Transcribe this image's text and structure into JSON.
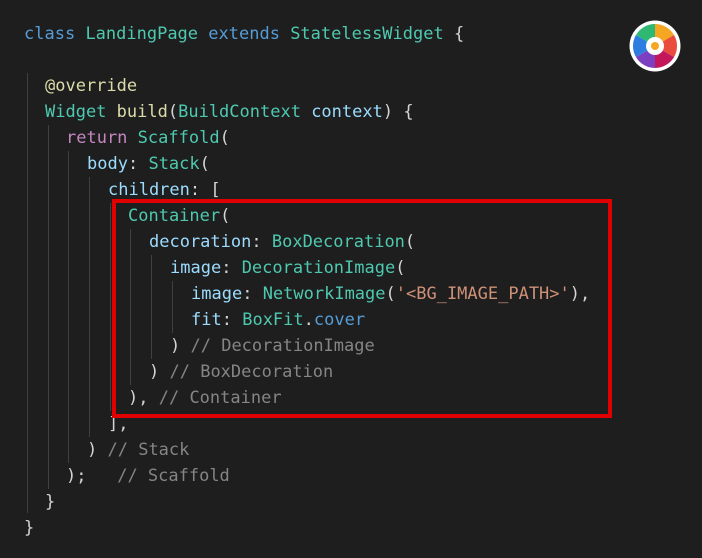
{
  "code": {
    "line1": {
      "kw_class": "class",
      "name": "LandingPage",
      "kw_extends": "extends",
      "parent": "StatelessWidget",
      "brace": "{"
    },
    "line2": {
      "decorator": "@override"
    },
    "line3": {
      "type": "Widget",
      "method": "build",
      "open": "(",
      "ptype": "BuildContext",
      "pname": "context",
      "close": ") {"
    },
    "line4": {
      "kw_return": "return",
      "cls": "Scaffold",
      "open": "("
    },
    "line5": {
      "prop": "body",
      "colon": ":",
      "cls": "Stack",
      "open": "("
    },
    "line6": {
      "prop": "children",
      "rest": ": ["
    },
    "line7": {
      "cls": "Container",
      "open": "("
    },
    "line8": {
      "prop": "decoration",
      "colon": ":",
      "cls": "BoxDecoration",
      "open": "("
    },
    "line9": {
      "prop": "image",
      "colon": ":",
      "cls": "DecorationImage",
      "open": "("
    },
    "line10": {
      "prop": "image",
      "colon": ":",
      "cls": "NetworkImage",
      "open": "(",
      "str": "'<BG_IMAGE_PATH>'",
      "close": "),"
    },
    "line11": {
      "prop": "fit",
      "colon": ":",
      "cls": "BoxFit",
      "dot": ".",
      "member": "cover"
    },
    "line12": {
      "close": ")",
      "comment": "// DecorationImage"
    },
    "line13": {
      "close": ")",
      "comment": "// BoxDecoration"
    },
    "line14": {
      "close": "),",
      "comment": "// Container"
    },
    "line15": {
      "close": "],"
    },
    "line16": {
      "close": ")",
      "comment": "// Stack"
    },
    "line17": {
      "close": ");",
      "comment": "// Scaffold"
    },
    "line18": {
      "close": "}"
    },
    "line19": {
      "close": "}"
    }
  },
  "annotation": {
    "box_color": "#e00000"
  },
  "logo": {
    "icon": "color-wheel-icon"
  }
}
